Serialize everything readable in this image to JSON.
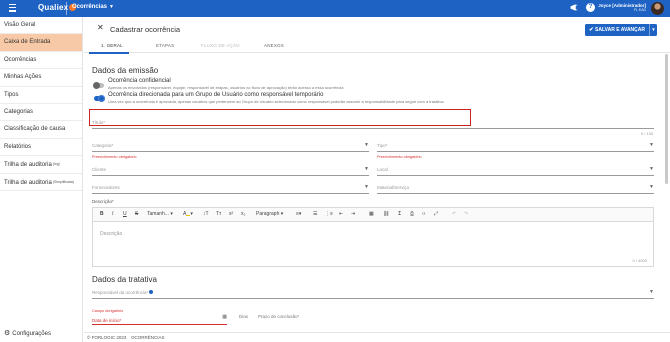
{
  "topbar": {
    "brand": "Qualiex",
    "module": "Ocorrências",
    "user_name": "Joyce [Administrador]",
    "user_company": "FL EAD",
    "accent": "#1e63c4"
  },
  "sidebar": {
    "items": [
      {
        "label": "Visão Geral",
        "sup": ""
      },
      {
        "label": "Caixa de Entrada",
        "sup": ""
      },
      {
        "label": "Ocorrências",
        "sup": ""
      },
      {
        "label": "Minhas Ações",
        "sup": ""
      },
      {
        "label": "Tipos",
        "sup": ""
      },
      {
        "label": "Categorias",
        "sup": ""
      },
      {
        "label": "Classificação de causa",
        "sup": ""
      },
      {
        "label": "Relatórios",
        "sup": ""
      },
      {
        "label": "Trilha de auditoria",
        "sup": "(log)"
      },
      {
        "label": "Trilha de auditoria",
        "sup": "(Simplificada)"
      }
    ],
    "settings": "Configurações"
  },
  "header": {
    "title": "Cadastrar ocorrência",
    "save_label": "SALVAR E AVANÇAR",
    "tabs": [
      "1. GERAL",
      "ETAPAS",
      "FLUXO DE AÇÃO",
      "ANEXOS"
    ]
  },
  "emissao": {
    "heading": "Dados da emissão",
    "opt1_title": "Ocorrência confidencial",
    "opt1_desc": "Apenas os envolvidos (responsável, equipe, responsável de etapas, usuários no fluxo de aprovação) terão acesso a essa ocorrência",
    "opt2_title": "Ocorrência direcionada para um Grupo de Usuário como responsável temporário",
    "opt2_desc": "Uma vez que a ocorrência é aprovada, apenas usuários que pertencem ao Grupo de Usuário selecionado como responsável poderão assumir a responsabilidade para seguir com a tratativa.",
    "titulo_label": "Título*",
    "titulo_counter": "0 / 100",
    "categoria_label": "Categoria*",
    "tipo_label": "Tipo*",
    "required_error": "Preenchimento obrigatório",
    "cliente_label": "Cliente",
    "local_label": "Local",
    "fornecedores_label": "Fornecedores",
    "material_label": "Material/Serviço",
    "descricao_label": "Descrição*",
    "descricao_placeholder": "Descrição",
    "descricao_counter": "0 / 4000",
    "toolbar": {
      "font": "Tamanh...",
      "paragraph": "Paragraph"
    }
  },
  "tratativa": {
    "heading": "Dados da tratativa",
    "responsavel_label": "Responsável da ocorrência*",
    "campo_error": "Campo obrigatório",
    "data_inicio_label": "Data de início*",
    "dias_label": "Dias",
    "prazo_label": "Prazo de conclusão*"
  },
  "footer": {
    "copyright": "© FORLOGIC 2023",
    "module": "OCORRÊNCIAS"
  }
}
